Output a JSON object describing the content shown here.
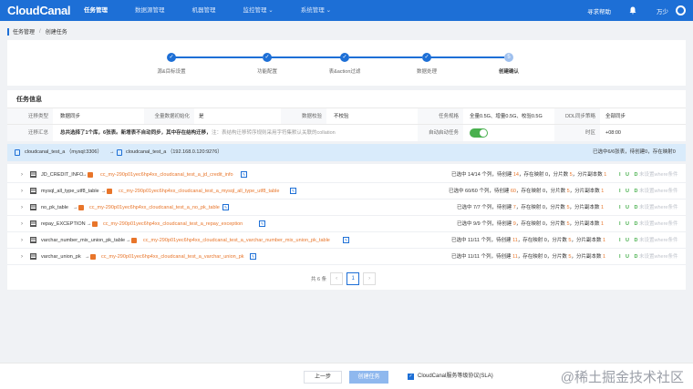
{
  "nav": {
    "logo": "CloudCanal",
    "items": [
      "任务管理",
      "数据源管理",
      "机器管理",
      "监控管理 ⌄",
      "系统管理 ⌄"
    ],
    "help": "寻求帮助",
    "user": "万少"
  },
  "breadcrumb": {
    "parent": "任务管理",
    "current": "创建任务"
  },
  "steps": [
    {
      "num": "✓",
      "label": "源&目标设置"
    },
    {
      "num": "✓",
      "label": "功能配置"
    },
    {
      "num": "✓",
      "label": "表&action过滤"
    },
    {
      "num": "✓",
      "label": "数据处理"
    },
    {
      "num": "5",
      "label": "创建确认"
    }
  ],
  "task_info": {
    "title": "任务信息",
    "row1": [
      {
        "label": "迁移类型",
        "value": "数据同步"
      },
      {
        "label": "全量数据初始化",
        "value": "是"
      },
      {
        "label": "数据校验",
        "value": "不校验"
      },
      {
        "label": "任务规格",
        "value": "全量0.5G、增量0.5G、校验0.5G"
      },
      {
        "label": "DDL同步策略",
        "value": "全部同步"
      }
    ],
    "row2": {
      "summary_label": "迁移汇总",
      "summary_value": "总共选择了1个库，6张表。新增表不自动同步，其中存在结构迁移，",
      "note": "注：表结构迁移转序规则采用字符集默认关联的collation",
      "autostart_label": "自动启动任务",
      "autostart_on": true,
      "timezone_label": "时区",
      "timezone_value": "+08:00"
    }
  },
  "mapping": {
    "source": "cloudcanal_test_a  （mysql:3306）",
    "target": "cloudcanal_test_a  （192.168.0.120:9276）",
    "summary": "已选中6/6张表，待创建0，存在映射0"
  },
  "tables": [
    {
      "src": "JD_CREDIT_INFO",
      "dst": "cc_my-290p01yec6hp4xx_cloudcanal_test_a_jd_credit_info",
      "selected": "已选中 14/14 个列，",
      "pending_label": "待创建",
      "pending": "14",
      "mapped": "，存在映射 0，分片数",
      "shard": "5",
      "replica": "，分片副本数",
      "replica_num": "1"
    },
    {
      "src": "mysql_all_type_utf8_table",
      "dst": "cc_my-290p01yec6hp4xx_cloudcanal_test_a_mysql_all_type_utf8_table",
      "selected": "已选中 60/60 个列，",
      "pending_label": "待创建",
      "pending": "60",
      "mapped": "，存在映射 0，分片数",
      "shard": "5",
      "replica": "，分片副本数",
      "replica_num": "1"
    },
    {
      "src": "no_pk_table",
      "dst": "cc_my-290p01yec6hp4xx_cloudcanal_test_a_no_pk_table",
      "selected": "已选中 7/7 个列，",
      "pending_label": "待创建",
      "pending": "7",
      "mapped": "，存在映射 0，分片数",
      "shard": "5",
      "replica": "，分片副本数",
      "replica_num": "1"
    },
    {
      "src": "repay_EXCEPTION",
      "dst": "cc_my-290p01yec6hp4xx_cloudcanal_test_a_repay_exception",
      "selected": "已选中 9/9 个列，",
      "pending_label": "待创建",
      "pending": "9",
      "mapped": "，存在映射 0，分片数",
      "shard": "5",
      "replica": "，分片副本数",
      "replica_num": "1"
    },
    {
      "src": "varchar_number_mix_union_pk_table",
      "dst": "cc_my-290p01yec6hp4xx_cloudcanal_test_a_varchar_number_mix_union_pk_table",
      "selected": "已选中 11/11 个列，",
      "pending_label": "待创建",
      "pending": "11",
      "mapped": "，存在映射 0，分片数",
      "shard": "5",
      "replica": "，分片副本数",
      "replica_num": "1"
    },
    {
      "src": "varchar_union_pk",
      "dst": "cc_my-290p01yec6hp4xx_cloudcanal_test_a_varchar_union_pk",
      "selected": "已选中 11/11 个列，",
      "pending_label": "待创建",
      "pending": "11",
      "mapped": "，存在映射 0，分片数",
      "shard": "5",
      "replica": "，分片副本数",
      "replica_num": "1"
    }
  ],
  "row_actions": {
    "iud": "I U D",
    "where": "未设置where条件"
  },
  "pager": {
    "total": "共 6 条",
    "prev": "‹",
    "page": "1",
    "next": "›"
  },
  "footer": {
    "prev": "上一步",
    "create": "创建任务",
    "sla": "CloudCanal服务等级协议(SLA)",
    "watermark": "@稀土掘金技术社区"
  }
}
